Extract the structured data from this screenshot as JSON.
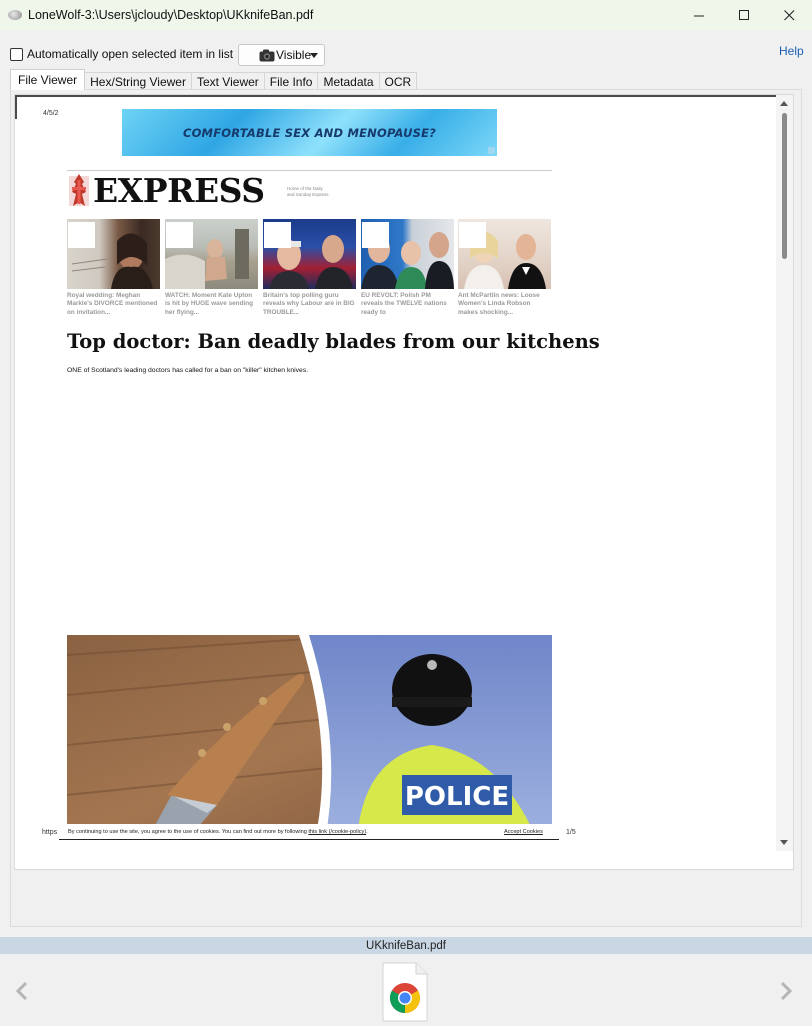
{
  "window": {
    "title": "LoneWolf-3:\\Users\\jcloudy\\Desktop\\UKknifeBan.pdf",
    "minimize_icon": "minimize-icon",
    "maximize_icon": "maximize-icon",
    "close_icon": "close-icon"
  },
  "toolbar": {
    "auto_open_label": "Automatically open selected item in list",
    "auto_open_checked": false,
    "visibility_selected": "Visible",
    "help_label": "Help"
  },
  "tabs": [
    {
      "label": "File Viewer",
      "active": true
    },
    {
      "label": "Hex/String Viewer",
      "active": false
    },
    {
      "label": "Text Viewer",
      "active": false
    },
    {
      "label": "File Info",
      "active": false
    },
    {
      "label": "Metadata",
      "active": false
    },
    {
      "label": "OCR",
      "active": false
    }
  ],
  "document": {
    "date_header": "4/5/2",
    "ad_text": "COMFORTABLE SEX AND MENOPAUSE?",
    "logo_text": "EXPRESS",
    "logo_tagline": "Home of the Daily and Sunday Express",
    "thumbnails": [
      {
        "caption": "Royal wedding: Meghan Markle's DIVORCE mentioned on invitation..."
      },
      {
        "caption": "WATCH: Moment Kate Upton is hit by HUGE wave sending her flying..."
      },
      {
        "caption": "Britain's top polling guru reveals why Labour are in BIG TROUBLE..."
      },
      {
        "caption": "EU REVOLT: Polish PM reveals the TWELVE nations ready to"
      },
      {
        "caption": "Ant McPartlin news: Loose Women's Linda Robson makes shocking..."
      }
    ],
    "headline": "Top doctor: Ban deadly blades from our kitchens",
    "standfirst": "ONE of Scotland's leading doctors has called for a ban on \"killer\" kitchen knives.",
    "hero_sign_text": "POLICE",
    "footer_url_fragment": "https",
    "cookie_text_before": "By continuing to use the site, you agree to the use of cookies. You can find out more by following ",
    "cookie_link": "this link (/cookie-policy)",
    "cookie_text_after": ".",
    "cookie_accept": "Accept Cookies",
    "page_indicator": "1/5"
  },
  "status": {
    "filename": "UKknifeBan.pdf"
  },
  "bottom": {
    "prev_icon": "chevron-left-icon",
    "next_icon": "chevron-right-icon",
    "file_icon": "chrome-pdf-file-icon"
  }
}
